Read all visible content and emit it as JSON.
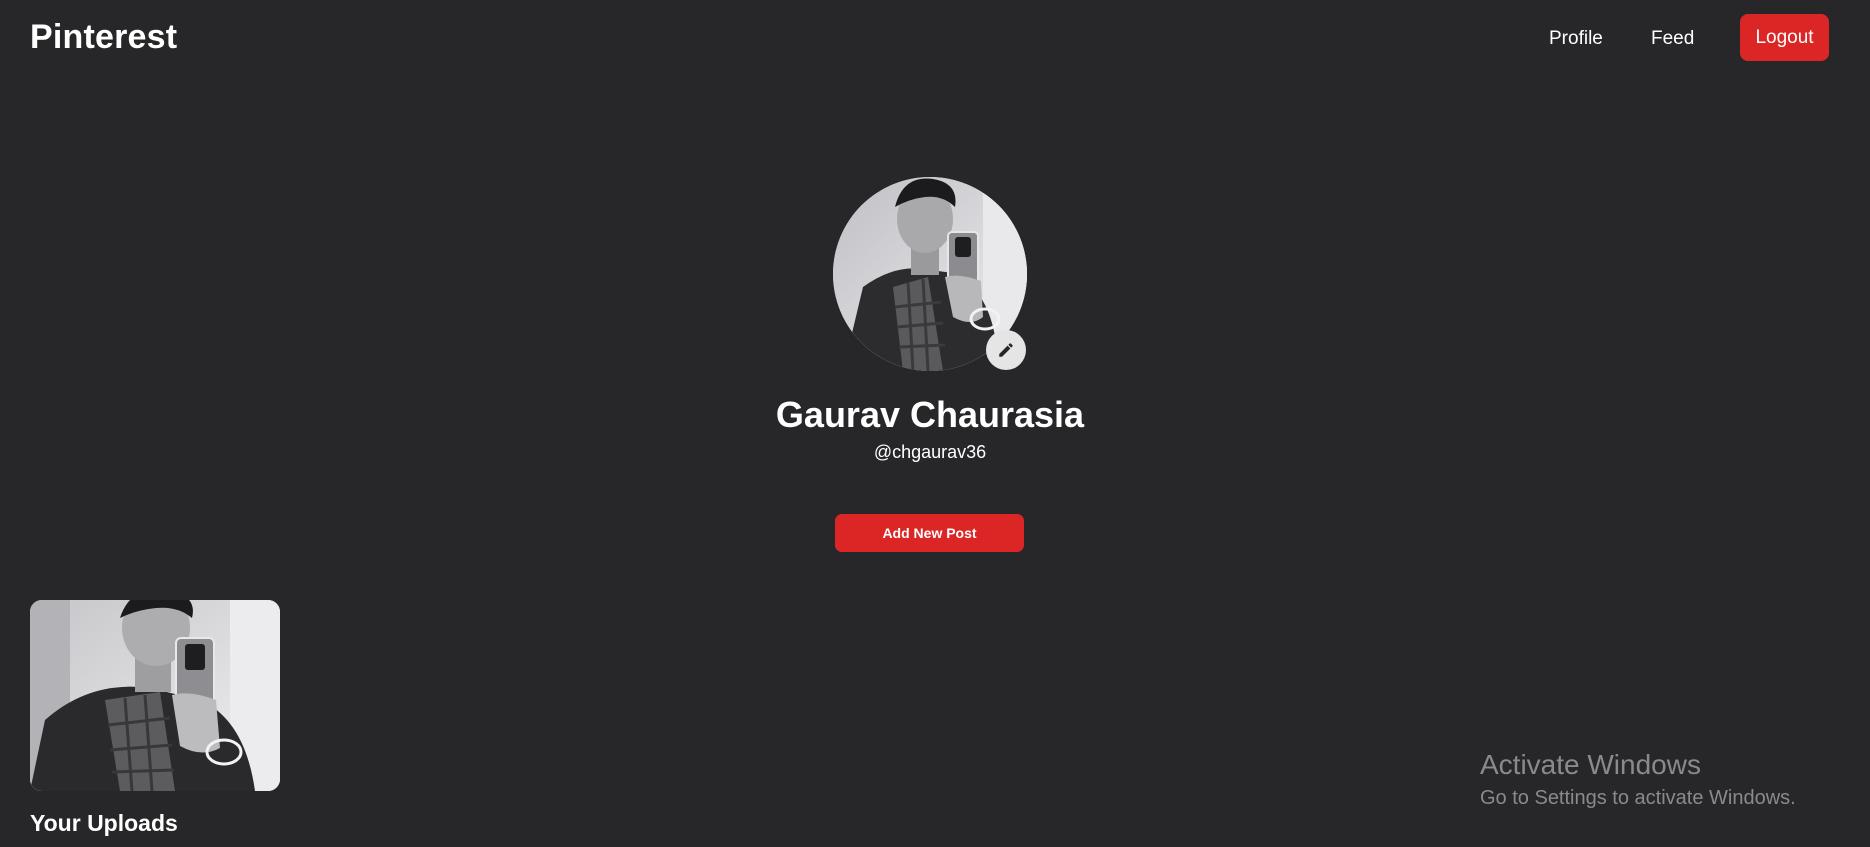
{
  "nav": {
    "brand": "Pinterest",
    "links": [
      "Profile",
      "Feed"
    ],
    "logout_label": "Logout"
  },
  "profile": {
    "name": "Gaurav Chaurasia",
    "handle": "@chgaurav36",
    "avatar_icon": "user-photo",
    "edit_icon": "pencil-icon",
    "add_post_label": "Add New Post"
  },
  "uploads": {
    "title": "Your Uploads"
  },
  "watermark": {
    "title": "Activate Windows",
    "subtitle": "Go to Settings to activate Windows."
  },
  "colors": {
    "background": "#27272a",
    "accent": "#dc2626",
    "text": "#ffffff"
  }
}
